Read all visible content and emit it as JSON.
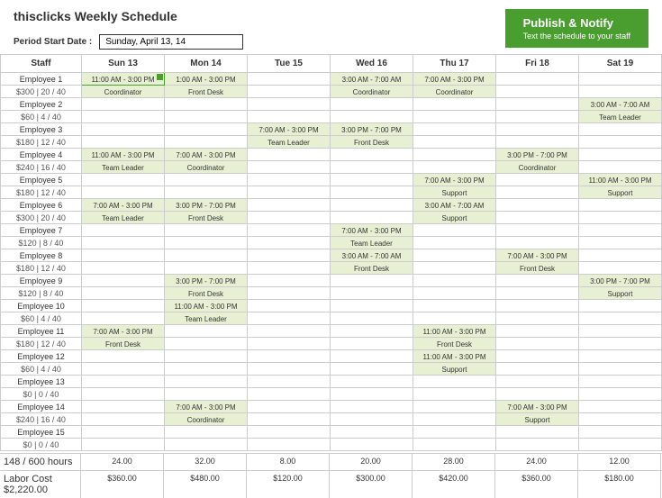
{
  "title": "thisclicks Weekly Schedule",
  "dateLabel": "Period Start Date :",
  "dateValue": "Sunday, April 13, 14",
  "publish": {
    "title": "Publish & Notify",
    "sub": "Text the schedule to your staff"
  },
  "days": [
    "Staff",
    "Sun 13",
    "Mon 14",
    "Tue 15",
    "Wed 16",
    "Thu 17",
    "Fri 18",
    "Sat 19"
  ],
  "employees": [
    {
      "name": "Employee 1",
      "meta": "$300 | 20 / 40",
      "shifts": {
        "0": {
          "t": "11:00 AM - 3:00 PM",
          "r": "Coordinator",
          "sel": true
        },
        "1": {
          "t": "1:00 AM - 3:00 PM",
          "r": "Front Desk"
        },
        "3": {
          "t": "3:00 AM - 7:00 AM",
          "r": "Coordinator"
        },
        "4": {
          "t": "7:00 AM - 3:00 PM",
          "r": "Coordinator"
        }
      }
    },
    {
      "name": "Employee 2",
      "meta": "$60 | 4 / 40",
      "shifts": {
        "6": {
          "t": "3:00 AM - 7:00 AM",
          "r": "Team Leader"
        }
      }
    },
    {
      "name": "Employee 3",
      "meta": "$180 | 12 / 40",
      "shifts": {
        "2": {
          "t": "7:00 AM - 3:00 PM",
          "r": "Team Leader"
        },
        "3": {
          "t": "3:00 PM - 7:00 PM",
          "r": "Front Desk"
        }
      }
    },
    {
      "name": "Employee 4",
      "meta": "$240 | 16 / 40",
      "shifts": {
        "0": {
          "t": "11:00 AM - 3:00 PM",
          "r": "Team Leader"
        },
        "1": {
          "t": "7:00 AM - 3:00 PM",
          "r": "Coordinator"
        },
        "5": {
          "t": "3:00 PM - 7:00 PM",
          "r": "Coordinator"
        }
      }
    },
    {
      "name": "Employee 5",
      "meta": "$180 | 12 / 40",
      "shifts": {
        "4": {
          "t": "7:00 AM - 3:00 PM",
          "r": "Support"
        },
        "6": {
          "t": "11:00 AM - 3:00 PM",
          "r": "Support"
        }
      }
    },
    {
      "name": "Employee 6",
      "meta": "$300 | 20 / 40",
      "shifts": {
        "0": {
          "t": "7:00 AM - 3:00 PM",
          "r": "Team Leader"
        },
        "1": {
          "t": "3:00 PM - 7:00 PM",
          "r": "Front Desk"
        },
        "4": {
          "t": "3:00 AM - 7:00 AM",
          "r": "Support"
        }
      }
    },
    {
      "name": "Employee 7",
      "meta": "$120 | 8 / 40",
      "shifts": {
        "3": {
          "t": "7:00 AM - 3:00 PM",
          "r": "Team Leader"
        }
      }
    },
    {
      "name": "Employee 8",
      "meta": "$180 | 12 / 40",
      "shifts": {
        "3": {
          "t": "3:00 AM - 7:00 AM",
          "r": "Front Desk"
        },
        "5": {
          "t": "7:00 AM - 3:00 PM",
          "r": "Front Desk"
        }
      }
    },
    {
      "name": "Employee 9",
      "meta": "$120 | 8 / 40",
      "shifts": {
        "1": {
          "t": "3:00 PM - 7:00 PM",
          "r": "Front Desk"
        },
        "6": {
          "t": "3:00 PM - 7:00 PM",
          "r": "Support"
        }
      }
    },
    {
      "name": "Employee 10",
      "meta": "$60 | 4 / 40",
      "shifts": {
        "1": {
          "t": "11:00 AM - 3:00 PM",
          "r": "Team Leader"
        }
      }
    },
    {
      "name": "Employee 11",
      "meta": "$180 | 12 / 40",
      "shifts": {
        "0": {
          "t": "7:00 AM - 3:00 PM",
          "r": "Front Desk"
        },
        "4": {
          "t": "11:00 AM - 3:00 PM",
          "r": "Front Desk"
        }
      }
    },
    {
      "name": "Employee 12",
      "meta": "$60 | 4 / 40",
      "shifts": {
        "4": {
          "t": "11:00 AM - 3:00 PM",
          "r": "Support"
        }
      }
    },
    {
      "name": "Employee 13",
      "meta": "$0 | 0 / 40",
      "shifts": {}
    },
    {
      "name": "Employee 14",
      "meta": "$240 | 16 / 40",
      "shifts": {
        "1": {
          "t": "7:00 AM - 3:00 PM",
          "r": "Coordinator"
        },
        "5": {
          "t": "7:00 AM - 3:00 PM",
          "r": "Support"
        }
      }
    },
    {
      "name": "Employee 15",
      "meta": "$0 | 0 / 40",
      "shifts": {}
    }
  ],
  "hoursLabel": "148 / 600 hours",
  "hours": [
    "24.00",
    "32.00",
    "8.00",
    "20.00",
    "28.00",
    "24.00",
    "12.00"
  ],
  "costLabel": "Labor Cost $2,220.00",
  "costs": [
    "$360.00",
    "$480.00",
    "$120.00",
    "$300.00",
    "$420.00",
    "$360.00",
    "$180.00"
  ]
}
